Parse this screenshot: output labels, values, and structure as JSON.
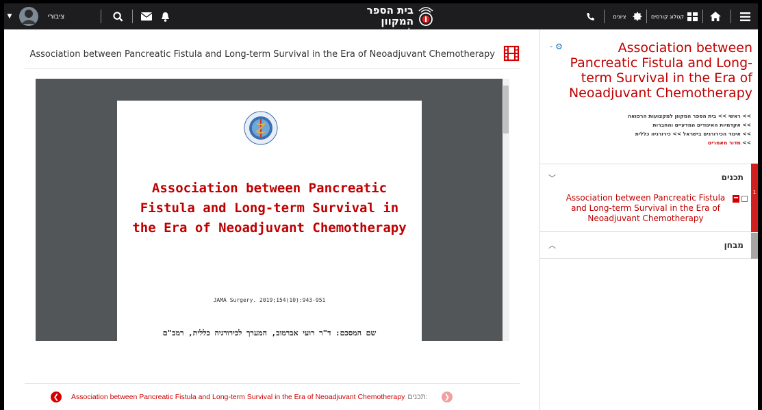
{
  "topbar": {
    "user_name": "ציבורי",
    "site_title_line1": "בית הספר המקוון",
    "site_title_line2": "למקצועות הרפואה",
    "course_catalog_label": "קטלוג קורסים",
    "grades_label": "ציונים"
  },
  "main": {
    "document_title": "Association between Pancreatic Fistula and Long-term Survival in the Era of Neoadjuvant Chemotherapy",
    "paper": {
      "title": "Association between Pancreatic Fistula and Long-term Survival in the Era of Neoadjuvant Chemotherapy",
      "reference": "JAMA Surgery. 2019;154(10):943-951",
      "author": "שם המסכם: ד\"ר רועי אברמוב, המערך לכירורגיה כללית, רמב\"ם"
    },
    "bottom_nav": {
      "label": "תכנים:",
      "item": "Association between Pancreatic Fistula and Long-term Survival in the Era of Neoadjuvant Chemotherapy"
    }
  },
  "sidebar": {
    "title": "Association between Pancreatic Fistula and Long-term Survival in the Era of Neoadjuvant Chemotherapy",
    "breadcrumb": [
      "ראשי",
      "בית הספר המקוון למקצועות הרפואה",
      "אקדמיות האיגודים המדעיים והחברות",
      "איגוד הכירורגים בישראל",
      "כירורגיה כללית",
      "מדור מאמרים"
    ],
    "contents_header": "תכנים",
    "contents_item": "Association between Pancreatic Fistula and Long-term Survival in the Era of Neoadjuvant Chemotherapy",
    "exam_header": "מבחן",
    "strip_number": "1"
  },
  "icons": [
    "hamburger-icon",
    "home-icon",
    "catalog-icon",
    "grades-badge-icon",
    "phone-icon",
    "bell-icon",
    "mail-icon",
    "search-icon",
    "avatar",
    "film-icon",
    "gear-icon",
    "pdf-icon",
    "checkbox"
  ],
  "colors": {
    "accent": "#c00000",
    "topbar": "#1d1d1f",
    "link_blue": "#1f74c9"
  }
}
